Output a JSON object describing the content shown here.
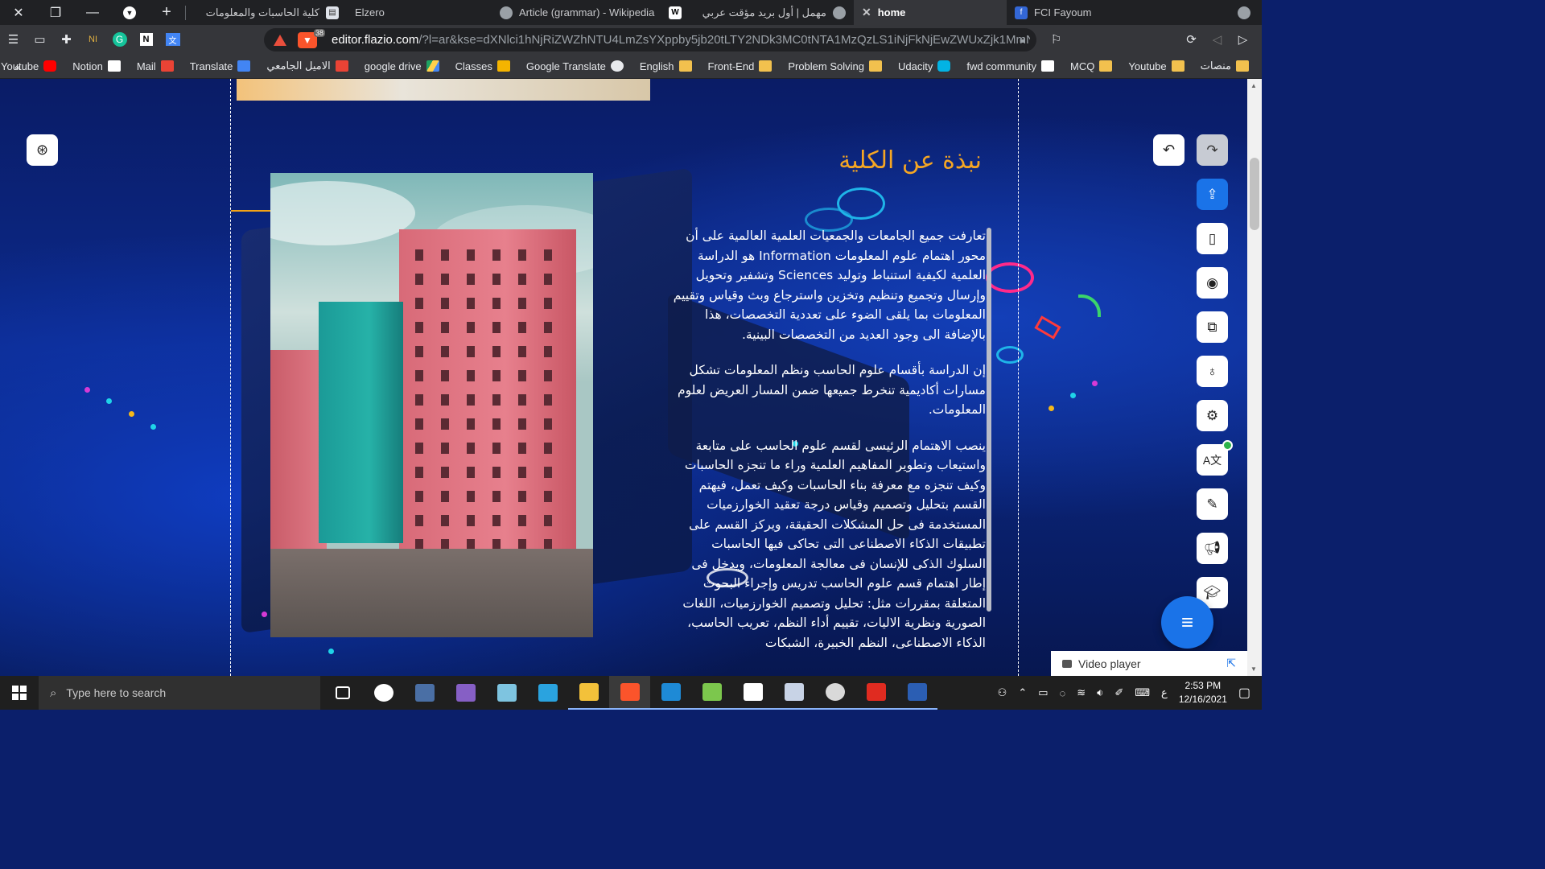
{
  "window": {
    "tabs": [
      {
        "title": "كلية الحاسبات والمعلومات",
        "fav_color": "#6b8fd6",
        "fav": "document-icon"
      },
      {
        "title": "Elzero",
        "fav_color": "#e6e6e6",
        "fav": "elzero-icon"
      },
      {
        "title": "Article (grammar) - Wikipedia",
        "fav_color": "#ffffff",
        "fav": "wikipedia-icon"
      },
      {
        "title": "مهمل | أول بريد مؤقت عربي",
        "fav_color": "#ffffff",
        "fav": "globe-icon"
      },
      {
        "title": "home",
        "fav_color": "#3367d6",
        "fav": "flazio-icon",
        "active": true
      },
      {
        "title": "FCI Fayoum",
        "fav_color": "#5a5a5a",
        "fav": "globe-icon"
      }
    ],
    "new_tab_label": "+",
    "tab_close_label": "✕",
    "win_close": "✕",
    "win_restore": "❐",
    "win_min": "—"
  },
  "toolbar": {
    "url_host": "editor.flazio.com",
    "url_path": "/?l=ar&kse=dXNlci1hNjRiZWZhNTU4LmZsYXppby5jb20tLTY2NDk3MC0tNTA1MzQzLS1iNjFkNjEwZWUxZjk1MmNhY...",
    "brave_count": "38"
  },
  "bookmarks": [
    {
      "label": "منصات",
      "icon_color": "#f2c14e"
    },
    {
      "label": "Youtube",
      "icon_color": "#f2c14e"
    },
    {
      "label": "MCQ",
      "icon_color": "#f2c14e"
    },
    {
      "label": "fwd community",
      "icon_color": "#ffffff"
    },
    {
      "label": "Udacity",
      "icon_color": "#02b3e4"
    },
    {
      "label": "Problem Solving",
      "icon_color": "#f2c14e"
    },
    {
      "label": "Front-End",
      "icon_color": "#f2c14e"
    },
    {
      "label": "English",
      "icon_color": "#f2c14e"
    },
    {
      "label": "Google Translate",
      "icon_color": "#e8eaed"
    },
    {
      "label": "Classes",
      "icon_color": "#f4b400"
    },
    {
      "label": "google drive",
      "icon_color": "#1fa463"
    },
    {
      "label": "الاميل الجامعي",
      "icon_color": "#ea4335"
    },
    {
      "label": "Translate",
      "icon_color": "#4285f4"
    },
    {
      "label": "Mail",
      "icon_color": "#ea4335"
    },
    {
      "label": "Notion",
      "icon_color": "#ffffff"
    },
    {
      "label": "Youtube",
      "icon_color": "#ff0000"
    }
  ],
  "bookmarks_overflow": "«",
  "page": {
    "section_title": "نبذة عن الكلية",
    "paragraphs": [
      "تعارفت جميع الجامعات والجمعيات العلمية العالمية على أن محور اهتمام علوم المعلومات Information هو الدراسة العلمية لكيفية استنباط وتوليد Sciences وتشفير وتحويل وإرسال وتجميع وتنظيم وتخزين واسترجاع وبث وقياس وتقييم المعلومات بما يلقى الضوء على تعددية التخصصات، هذا بالإضافة الى وجود العديد من التخصصات البينية.",
      "إن الدراسة بأقسام علوم الحاسب ونظم المعلومات تشكل مسارات أكاديمية تنخرط جميعها ضمن المسار العريض لعلوم المعلومات.",
      "ينصب الاهتمام الرئيسى لقسم علوم الحاسب على متابعة واستيعاب وتطوير المفاهيم العلمية وراء ما تنجزه الحاسبات وكيف تنجزه مع معرفة بناء الحاسبات وكيف تعمل، فيهتم القسم بتحليل وتصميم وقياس درجة تعقيد الخوارزميات المستخدمة فى حل المشكلات الحقيقة، ويركز القسم على تطبيقات الذكاء الاصطناعى التى تحاكى فيها الحاسبات السلوك الذكى للإنسان فى معالجة المعلومات، ويدخل فى إطار اهتمام قسم علوم الحاسب تدريس وإجراء البحوث المتعلقة بمقررات مثل: تحليل وتصميم الخوارزميات، اللغات الصورية ونظرية الاليات، تقييم أداء النظم، تعريب الحاسب، الذكاء الاصطناعى، النظم الخبيرة، الشبكات"
    ],
    "photo_alt": "campus building photo"
  },
  "editor": {
    "video_player_label": "Video player",
    "right_tools": [
      "upload-icon",
      "mobile-icon",
      "eye-icon",
      "copy-icon",
      "lightbulb-icon",
      "gear-icon",
      "translate-icon",
      "brush-icon",
      "megaphone-icon",
      "graduation-cap-icon"
    ]
  },
  "taskbar": {
    "search_placeholder": "Type here to search",
    "time": "2:53 PM",
    "date": "12/16/2021",
    "lang": "ع",
    "apps": [
      {
        "name": "task-view",
        "color": "#ffffff"
      },
      {
        "name": "cat-app",
        "color": "#ffffff"
      },
      {
        "name": "calculator",
        "color": "#4a6fa5"
      },
      {
        "name": "visual-studio",
        "color": "#865fc5"
      },
      {
        "name": "notes-app",
        "color": "#7ec4e0"
      },
      {
        "name": "telegram",
        "color": "#2aa3df"
      },
      {
        "name": "file-explorer",
        "color": "#f3c13a"
      },
      {
        "name": "brave",
        "color": "#fb542b",
        "active": true
      },
      {
        "name": "vscode",
        "color": "#1e8ad6"
      },
      {
        "name": "lambda-app",
        "color": "#7cc74d"
      },
      {
        "name": "notion",
        "color": "#ffffff"
      },
      {
        "name": "network-app",
        "color": "#c8d3e6"
      },
      {
        "name": "linux-app",
        "color": "#d9d9d9"
      },
      {
        "name": "pdf-reader",
        "color": "#e02b20"
      },
      {
        "name": "word",
        "color": "#2b5eb3"
      }
    ]
  }
}
